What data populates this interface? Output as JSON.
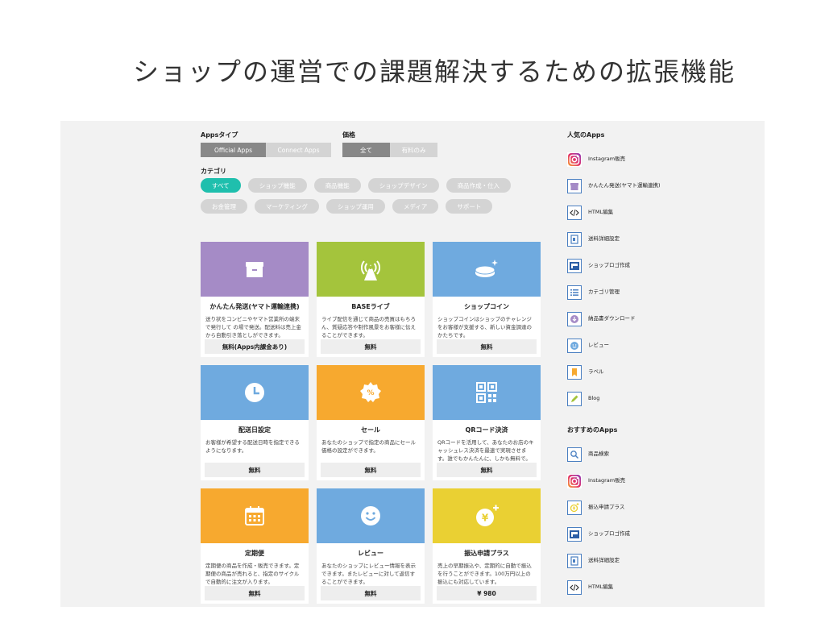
{
  "slide_title": "ショップの運営での課題解決するための拡張機能",
  "filters": {
    "apps_type_label": "Appsタイプ",
    "apps_type_options": [
      "Official Apps",
      "Connect Apps"
    ],
    "price_label": "価格",
    "price_options": [
      "全て",
      "有料のみ"
    ],
    "category_label": "カテゴリ",
    "categories": [
      "すべて",
      "ショップ機能",
      "商品機能",
      "ショップデザイン",
      "商品作成・仕入",
      "お金管理",
      "マーケティング",
      "ショップ運用",
      "メディア",
      "サポート"
    ]
  },
  "colors": {
    "accent": "#1fbfad",
    "purple": "#a58bc6",
    "green": "#a4c43c",
    "blue": "#6faadf",
    "orange": "#f7a92f",
    "yellow": "#ead033"
  },
  "cards": [
    {
      "title": "かんたん発送(ヤマト運輸連携)",
      "desc": "送り状をコンビニやヤマト営業所の端末で発行して の場で発送。配送料は売上金から自動引き落としができます。",
      "price": "無料(Apps内課金あり)",
      "icon": "package-icon"
    },
    {
      "title": "BASEライブ",
      "desc": "ライブ配信を通じて商品の売買はもちろん、質疑応答や制作風景をお客様に伝えることができます。",
      "price": "無料",
      "icon": "live-broadcast-icon"
    },
    {
      "title": "ショップコイン",
      "desc": "ショップコインはショップのチャレンジをお客様が支援する、新しい資金調達のかたちです。",
      "price": "無料",
      "icon": "coin-icon"
    },
    {
      "title": "配送日設定",
      "desc": "お客様が希望する配送日時を指定できるようになります。",
      "price": "無料",
      "icon": "clock-icon"
    },
    {
      "title": "セール",
      "desc": "あなたのショップで指定の商品にセール価格の設定ができます。",
      "price": "無料",
      "icon": "discount-badge-icon"
    },
    {
      "title": "QRコード決済",
      "desc": "QRコードを活用して、あなたのお店のキャッシュレス決済を最速で実現させます。誰でもかんたんに、しかも無料で。",
      "price": "無料",
      "icon": "qr-code-icon"
    },
    {
      "title": "定期便",
      "desc": "定期便の商品を作成・販売できます。定期便の商品が売れると、指定のサイクルで自動的に注文が入ります。",
      "price": "無料",
      "icon": "calendar-icon"
    },
    {
      "title": "レビュー",
      "desc": "あなたのショップにレビュー情報を表示できます。またレビューに対して返信することができます。",
      "price": "無料",
      "icon": "smile-icon"
    },
    {
      "title": "振込申請プラス",
      "desc": "売上の早期振込や、定期的に自動で振込を行うことができます。100万円以上の振込にも対応しています。",
      "price": "¥ 980",
      "icon": "yen-coin-plus-icon"
    }
  ],
  "sidebar": {
    "popular_title": "人気のApps",
    "popular": [
      {
        "label": "Instagram販売",
        "icon": "instagram-icon"
      },
      {
        "label": "かんたん発送(ヤマト運輸連携)",
        "icon": "package-icon"
      },
      {
        "label": "HTML編集",
        "icon": "code-icon"
      },
      {
        "label": "送料詳細設定",
        "icon": "document-icon"
      },
      {
        "label": "ショップロゴ作成",
        "icon": "flag-icon"
      },
      {
        "label": "カテゴリ管理",
        "icon": "list-icon"
      },
      {
        "label": "納品書ダウンロード",
        "icon": "download-icon"
      },
      {
        "label": "レビュー",
        "icon": "smile-icon"
      },
      {
        "label": "ラベル",
        "icon": "bookmark-icon"
      },
      {
        "label": "Blog",
        "icon": "pencil-icon"
      }
    ],
    "recommended_title": "おすすめのApps",
    "recommended": [
      {
        "label": "商品検索",
        "icon": "search-icon"
      },
      {
        "label": "Instagram販売",
        "icon": "instagram-icon"
      },
      {
        "label": "振込申請プラス",
        "icon": "yen-coin-plus-icon"
      },
      {
        "label": "ショップロゴ作成",
        "icon": "flag-icon"
      },
      {
        "label": "送料詳細設定",
        "icon": "document-icon"
      },
      {
        "label": "HTML編集",
        "icon": "code-icon"
      }
    ]
  }
}
